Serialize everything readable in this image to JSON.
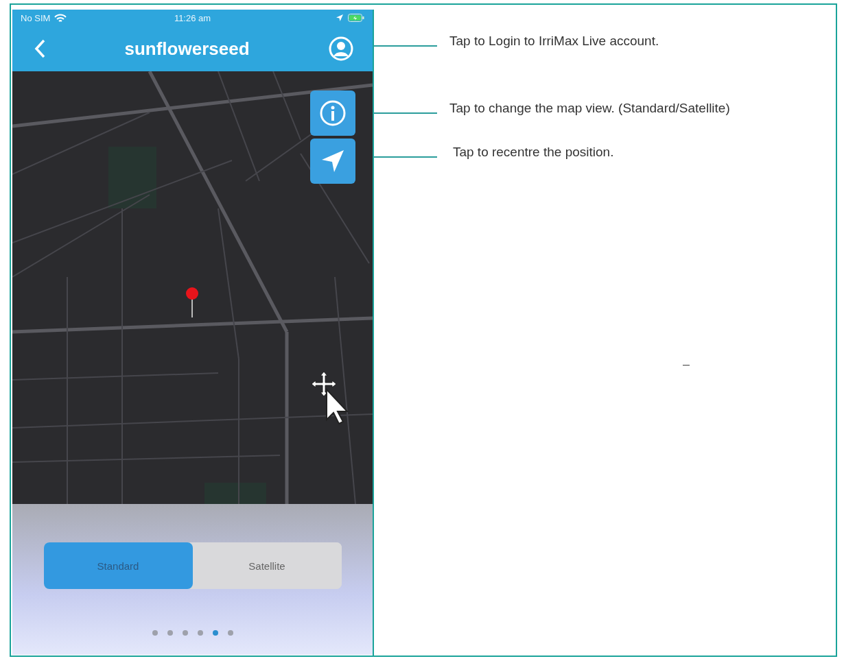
{
  "status_bar": {
    "carrier": "No SIM",
    "time": "11:26 am"
  },
  "nav_bar": {
    "title": "sunflowerseed"
  },
  "map_view": {
    "segments": [
      {
        "label": "Standard",
        "selected": true
      },
      {
        "label": "Satellite",
        "selected": false
      }
    ],
    "page_dots": [
      {
        "selected": false
      },
      {
        "selected": false
      },
      {
        "selected": false
      },
      {
        "selected": false
      },
      {
        "selected": true
      },
      {
        "selected": false
      }
    ]
  },
  "annotations": [
    {
      "text": "Tap to Login to IrriMax Live account."
    },
    {
      "text": "Tap to change the map view. (Standard/Satellite)"
    },
    {
      "text": " Tap to recentre the position."
    }
  ],
  "stray_mark": "–"
}
